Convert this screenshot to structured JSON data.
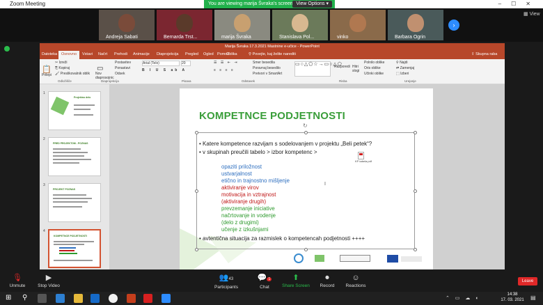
{
  "zoom": {
    "window_title": "Zoom Meeting",
    "banner_text": "You are viewing marija Švraka's screen",
    "view_options": "View Options",
    "view_label": "View",
    "participants_count": "43",
    "chat_badge": "1"
  },
  "gallery": [
    {
      "name": "Andreja Sabati"
    },
    {
      "name": "Bernarda Trst..."
    },
    {
      "name": "marija Švraka"
    },
    {
      "name": "Stanislava Pol..."
    },
    {
      "name": "vinko"
    },
    {
      "name": "Barbara Ogrin"
    }
  ],
  "ppt": {
    "title": "Marija Švraka 17.3.2021 Mastnine e-učice - PowerPoint",
    "tabs": [
      "Datoteka",
      "Osnovno",
      "Vstavi",
      "Načrt",
      "Prehodi",
      "Animacije",
      "Diaprojekcija",
      "Pregled",
      "Ogled",
      "Pomoč",
      "Oblika"
    ],
    "tell_me": "Povejte, kaj želite narediti",
    "share": "Skupna raba",
    "ribbon": {
      "paste": "Prilepi",
      "cut": "Izreži",
      "copy": "Kopiraj",
      "format_painter": "Preslikovalnik oblik",
      "clipboard": "Odložišče",
      "new_slide": "Nov diaprosojnic",
      "layout": "Postavitev",
      "reset": "Ponastavi",
      "section": "Odsek",
      "slides": "Diaprojekcija",
      "font_name": "Arial (Telo)",
      "font_size": "20",
      "font": "Pisava",
      "text_direction": "Smer besedila",
      "align_text": "Poravnaj besedilo",
      "smartart": "Pretvori v SmartArt",
      "paragraph": "Odstavek",
      "arrange": "Razporedi",
      "quick_styles": "Hitri slogi",
      "drawing": "Risba",
      "shape_fill": "Polnilo oblike",
      "shape_outline": "Oris oblike",
      "shape_effects": "Učinki oblike",
      "find": "Najdi",
      "replace": "Zamenjaj",
      "select": "Izberi",
      "editing": "Urejanje"
    },
    "thumbnails": [
      {
        "num": "1",
        "title": "Projektno delo"
      },
      {
        "num": "2",
        "title": "PRED PROJEKTOM - POZNAS"
      },
      {
        "num": "3",
        "title": "PROJEKT POZNAS"
      },
      {
        "num": "4",
        "title": "KOMPETNCE PODJETNOSTI"
      }
    ],
    "slide": {
      "title": "KOMPETNCE PODJETNOSTI",
      "bullets": [
        "Katere kompetence razvijam s sodelovanjem v projektu „Beli petek“?",
        "v skupinah preučili tabelo > izbor kompetenc >"
      ],
      "file_label": "KP tabela.pdf",
      "competences": [
        {
          "text": "opaziti priložnost",
          "color": "#2e6fbf"
        },
        {
          "text": "ustvarjalnost",
          "color": "#2e6fbf"
        },
        {
          "text": "etično in trajnostno mišljenje",
          "color": "#2e6fbf"
        },
        {
          "text": "aktiviranje virov",
          "color": "#c01818"
        },
        {
          "text": "motivacija in vztrajnost",
          "color": "#c01818"
        },
        {
          "text": "(aktiviranje drugih)",
          "color": "#c01818"
        },
        {
          "text": "prevzemanje iniciative",
          "color": "#2e9a2e"
        },
        {
          "text": "načrtovanje in vodenje",
          "color": "#2e9a2e"
        },
        {
          "text": "(delo z drugimi)",
          "color": "#2e9a2e"
        },
        {
          "text": "učenje z izkušnjami",
          "color": "#2e9a2e"
        }
      ],
      "last_bullet": "avtentična situacija za razmislek o kompetencah podjetnosti  ++++"
    }
  },
  "controls": {
    "unmute": "Unmute",
    "stop_video": "Stop Video",
    "participants": "Participants",
    "chat": "Chat",
    "share_screen": "Share Screen",
    "record": "Record",
    "reactions": "Reactions",
    "leave": "Leave"
  },
  "taskbar": {
    "time": "14:38",
    "date": "17. 03. 2021"
  }
}
